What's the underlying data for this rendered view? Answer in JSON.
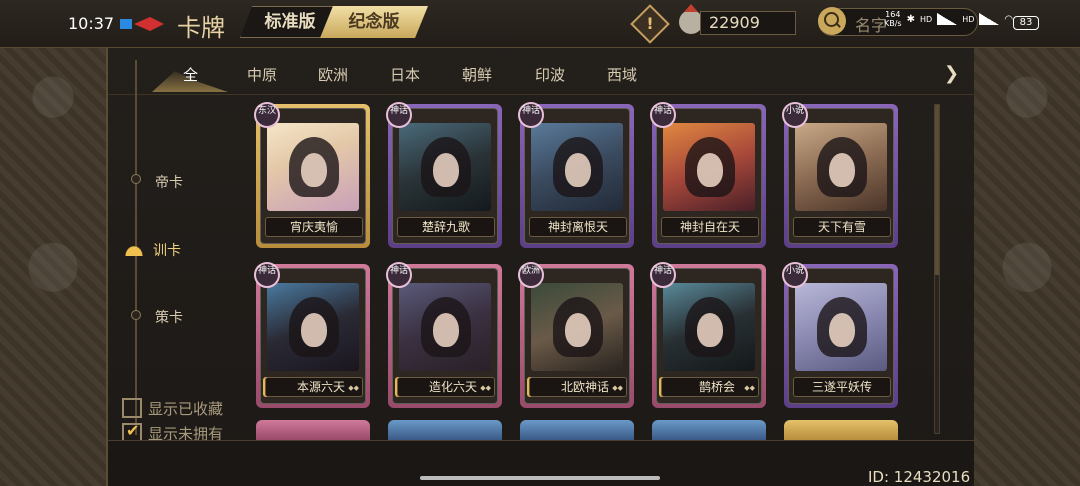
{
  "status": {
    "time": "10:37",
    "net_speed": "164\nKB/s",
    "hd1": "HD",
    "hd2": "HD",
    "battery": "83"
  },
  "header": {
    "title": "卡牌",
    "version_tabs": [
      "标准版",
      "纪念版"
    ],
    "active_version": "纪念版",
    "currency_value": "22909",
    "search_placeholder": "名字",
    "alert_symbol": "!"
  },
  "category_tabs": [
    "全",
    "中原",
    "欧洲",
    "日本",
    "朝鲜",
    "印波",
    "西域"
  ],
  "active_category": "全",
  "rarity_filters": [
    "帝卡",
    "训卡",
    "策卡"
  ],
  "active_rarity": "训卡",
  "filters": {
    "show_collected": {
      "label": "显示已收藏",
      "checked": false
    },
    "show_not_owned": {
      "label": "显示未拥有",
      "checked": true
    }
  },
  "cards": [
    {
      "name": "宵庆夷愉",
      "badge": "东汉",
      "frame": "gold"
    },
    {
      "name": "楚辞九歌",
      "badge": "神话",
      "frame": "purple"
    },
    {
      "name": "神封离恨天",
      "badge": "神话",
      "frame": "purple"
    },
    {
      "name": "神封自在天",
      "badge": "神话",
      "frame": "purple"
    },
    {
      "name": "天下有雪",
      "badge": "小说",
      "frame": "purple"
    },
    {
      "name": "本源六天",
      "badge": "神话",
      "frame": "pink"
    },
    {
      "name": "造化六天",
      "badge": "神话",
      "frame": "pink"
    },
    {
      "name": "北欧神话",
      "badge": "欧洲",
      "frame": "pink"
    },
    {
      "name": "鹊桥会",
      "badge": "神话",
      "frame": "pink"
    },
    {
      "name": "三遂平妖传",
      "badge": "小说",
      "frame": "purple"
    }
  ],
  "footer": {
    "id_text": "ID: 12432016"
  },
  "colors": {
    "gold": "#c9a85c",
    "purple": "#7355a0",
    "pink": "#b8607e"
  }
}
